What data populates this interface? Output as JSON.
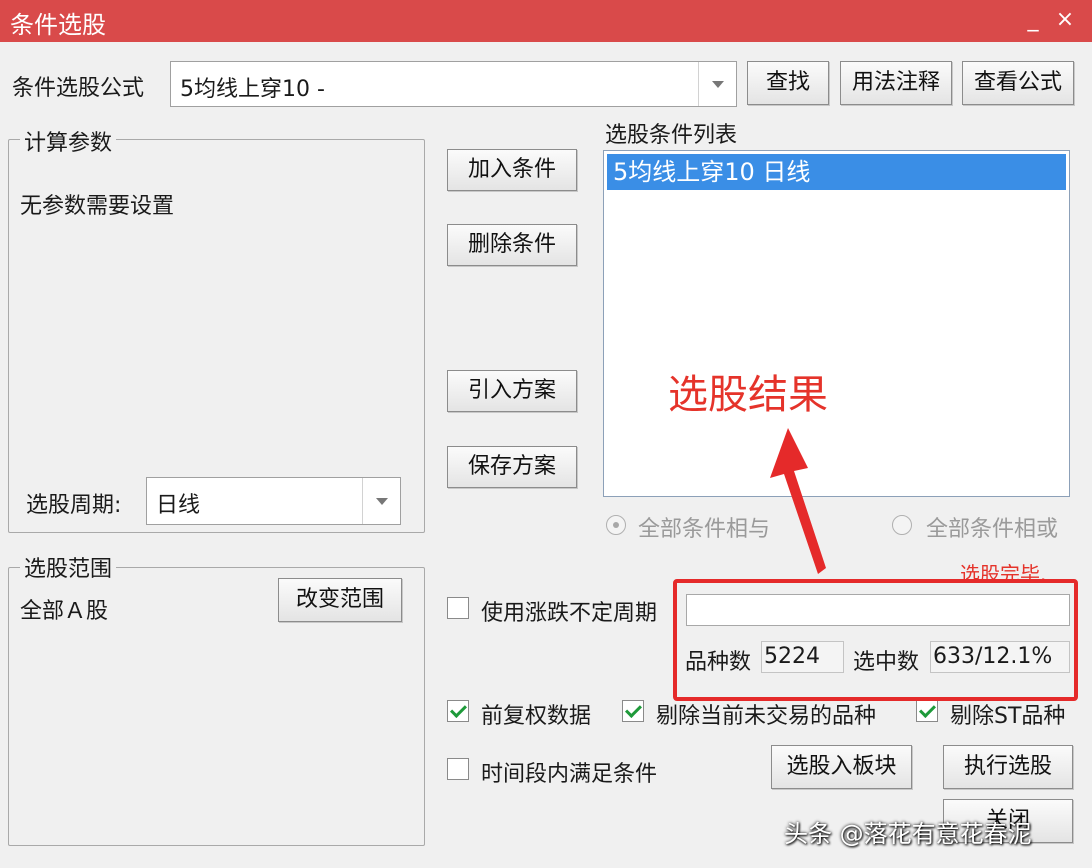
{
  "window": {
    "title": "条件选股",
    "minimize": "_",
    "close": "×"
  },
  "formula": {
    "label": "条件选股公式",
    "value": "5均线上穿10   -"
  },
  "buttons": {
    "find": "查找",
    "usage": "用法注释",
    "view": "查看公式",
    "add": "加入条件",
    "delete": "删除条件",
    "import": "引入方案",
    "save": "保存方案",
    "change_range": "改变范围",
    "to_block": "选股入板块",
    "execute": "执行选股",
    "close": "关闭"
  },
  "params": {
    "title": "计算参数",
    "none_text": "无参数需要设置",
    "period_label": "选股周期:",
    "period_value": "日线"
  },
  "conditions": {
    "title": "选股条件列表",
    "items": [
      "5均线上穿10  日线"
    ]
  },
  "logic": {
    "and_label": "全部条件相与",
    "or_label": "全部条件相或",
    "selected": "and"
  },
  "range": {
    "title": "选股范围",
    "value": "全部Ａ股"
  },
  "options": {
    "uncertain_period": {
      "label": "使用涨跌不定周期",
      "checked": false
    },
    "fq": {
      "label": "前复权数据",
      "checked": true
    },
    "exclude_untraded": {
      "label": "剔除当前未交易的品种",
      "checked": true
    },
    "exclude_st": {
      "label": "剔除ST品种",
      "checked": true
    },
    "time_range": {
      "label": "时间段内满足条件",
      "checked": false
    }
  },
  "result": {
    "status": "选股完毕.",
    "progress": 1.0,
    "count_label": "品种数",
    "count_value": "5224",
    "selected_label": "选中数",
    "selected_value": "633/12.1%"
  },
  "annotation": {
    "text": "选股结果",
    "color": "#e5332a"
  },
  "watermark": "头条 @落花有意花春泥",
  "colors": {
    "titlebar": "#d94a4a",
    "selection": "#3a8ee6",
    "annotation": "#e52a2a",
    "check": "#1e9a3a"
  }
}
